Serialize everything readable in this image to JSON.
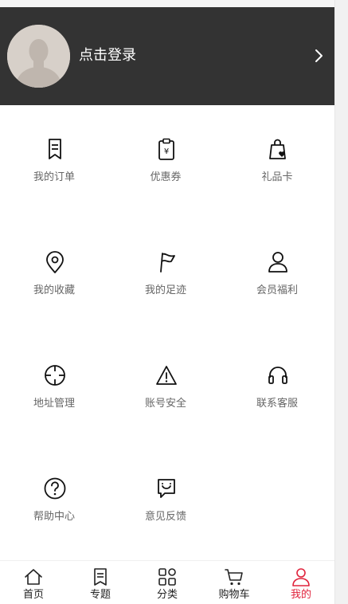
{
  "header": {
    "login_text": "点击登录"
  },
  "grid": {
    "items": [
      {
        "label": "我的订单",
        "icon": "order-icon"
      },
      {
        "label": "优惠券",
        "icon": "coupon-icon"
      },
      {
        "label": "礼品卡",
        "icon": "gift-card-icon"
      },
      {
        "label": "我的收藏",
        "icon": "location-pin-icon"
      },
      {
        "label": "我的足迹",
        "icon": "flag-icon"
      },
      {
        "label": "会员福利",
        "icon": "member-icon"
      },
      {
        "label": "地址管理",
        "icon": "crosshair-icon"
      },
      {
        "label": "账号安全",
        "icon": "warning-icon"
      },
      {
        "label": "联系客服",
        "icon": "headset-icon"
      },
      {
        "label": "帮助中心",
        "icon": "help-icon"
      },
      {
        "label": "意见反馈",
        "icon": "feedback-icon"
      }
    ]
  },
  "tabbar": {
    "items": [
      {
        "label": "首页",
        "icon": "home-icon"
      },
      {
        "label": "专题",
        "icon": "topic-icon"
      },
      {
        "label": "分类",
        "icon": "category-icon"
      },
      {
        "label": "购物车",
        "icon": "cart-icon"
      },
      {
        "label": "我的",
        "icon": "user-icon",
        "active": true
      }
    ],
    "active_color": "#e0233c"
  },
  "colors": {
    "header_bg": "#333333",
    "label_gray": "#666666"
  }
}
